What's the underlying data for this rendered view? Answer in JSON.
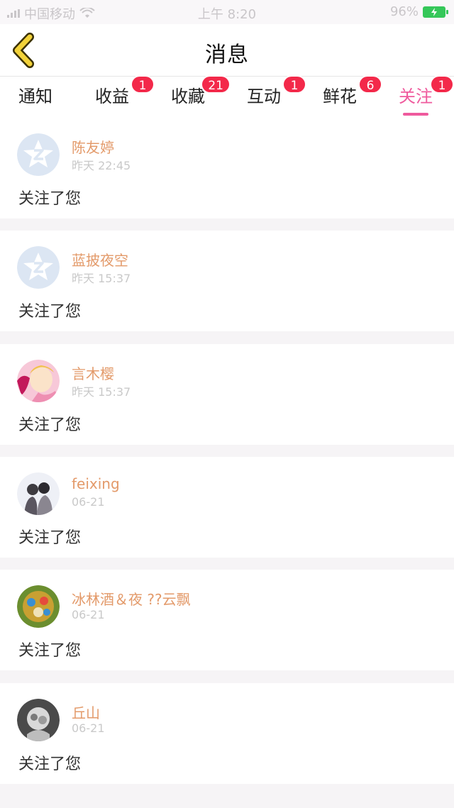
{
  "status_bar": {
    "carrier": "中国移动",
    "time": "上午 8:20",
    "battery": "96%"
  },
  "nav": {
    "title": "消息"
  },
  "tabs": [
    {
      "label": "通知",
      "badge": ""
    },
    {
      "label": "收益",
      "badge": "1"
    },
    {
      "label": "收藏",
      "badge": "21"
    },
    {
      "label": "互动",
      "badge": "1"
    },
    {
      "label": "鲜花",
      "badge": "6"
    },
    {
      "label": "关注",
      "badge": "1",
      "active": true
    }
  ],
  "items": [
    {
      "name": "陈友婷",
      "time": "昨天 22:45",
      "action": "关注了您",
      "avatar": "default-avatar-icon"
    },
    {
      "name": "蓝披夜空",
      "time": "昨天 15:37",
      "action": "关注了您",
      "avatar": "default-avatar-icon"
    },
    {
      "name": "言木樱",
      "time": "昨天 15:37",
      "action": "关注了您",
      "avatar": "photo-avatar"
    },
    {
      "name": "feixing",
      "time": "06-21",
      "action": "关注了您",
      "avatar": "photo-avatar"
    },
    {
      "name": "冰林酒＆夜 ??云飘",
      "time": "06-21",
      "action": "关注了您",
      "avatar": "photo-avatar"
    },
    {
      "name": "丘山",
      "time": "06-21",
      "action": "关注了您",
      "avatar": "photo-avatar"
    }
  ],
  "colors": {
    "accent": "#ef5a9d",
    "badge": "#f3294a",
    "username": "#e39a6a",
    "back_icon": "#f2d23a"
  }
}
